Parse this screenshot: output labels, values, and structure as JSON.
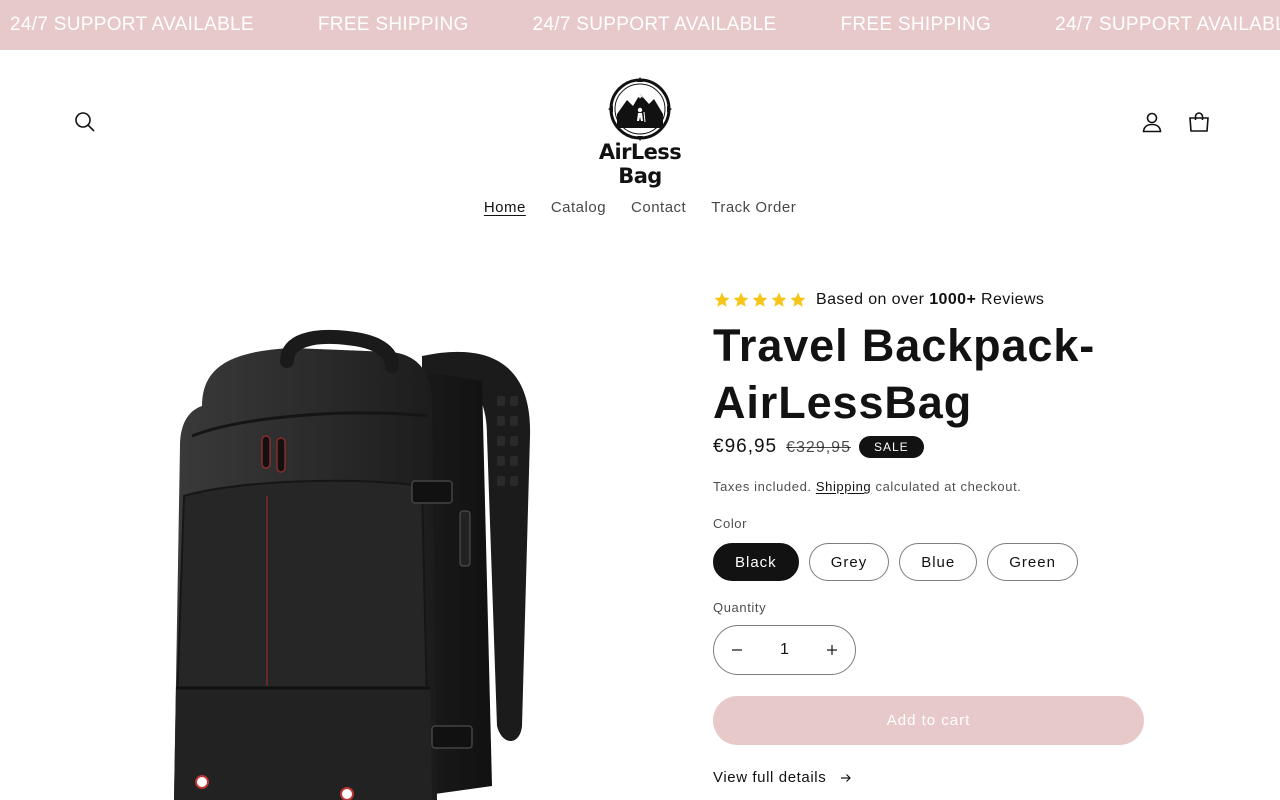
{
  "announcement": {
    "items": [
      "24/7 SUPPORT AVAILABLE",
      "FREE SHIPPING",
      "24/7 SUPPORT AVAILABLE",
      "FREE SHIPPING",
      "24/7 SUPPORT AVAILABLE"
    ]
  },
  "header": {
    "logo_text": "AirLess Bag",
    "icons": {
      "search": "search-icon",
      "account": "account-icon",
      "cart": "cart-icon"
    }
  },
  "nav": {
    "items": [
      {
        "label": "Home",
        "active": true
      },
      {
        "label": "Catalog",
        "active": false
      },
      {
        "label": "Contact",
        "active": false
      },
      {
        "label": "Track Order",
        "active": false
      }
    ]
  },
  "product": {
    "rating": {
      "stars": 5,
      "prefix": "Based on over",
      "count": "1000+",
      "suffix": "Reviews",
      "star_color": "#f5c518"
    },
    "title": "Travel Backpack- AirLessBag",
    "price": "€96,95",
    "compare_price": "€329,95",
    "badge": "SALE",
    "tax_prefix": "Taxes included.",
    "tax_link": "Shipping",
    "tax_suffix": "calculated at checkout.",
    "color_label": "Color",
    "colors": [
      {
        "label": "Black",
        "selected": true
      },
      {
        "label": "Grey",
        "selected": false
      },
      {
        "label": "Blue",
        "selected": false
      },
      {
        "label": "Green",
        "selected": false
      }
    ],
    "quantity_label": "Quantity",
    "quantity": "1",
    "add_to_cart": "Add to cart",
    "view_details": "View full details"
  },
  "colors": {
    "announcement_bg": "#e8c9c9",
    "button_bg": "#e8c9c9",
    "text": "#121212"
  }
}
